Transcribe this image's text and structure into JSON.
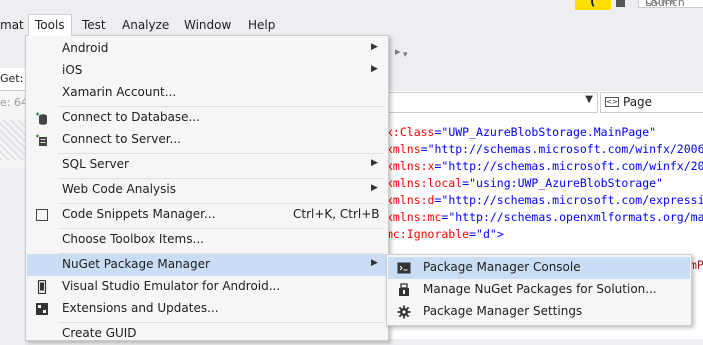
{
  "menubar": {
    "items": [
      "mat",
      "Tools",
      "Test",
      "Analyze",
      "Window",
      "Help"
    ],
    "quick_launch_placeholder": "Quick Launch"
  },
  "left_panel": {
    "tab_label": "Get: U",
    "size_label": "e: 64"
  },
  "editor": {
    "page_dropdown": "Page",
    "lines": [
      {
        "parts": [
          [
            "attr",
            "x:Class"
          ],
          [
            "sym",
            "="
          ],
          [
            "val",
            "\"UWP_AzureBlobStorage.MainPage\""
          ]
        ]
      },
      {
        "parts": [
          [
            "attr",
            "xmlns"
          ],
          [
            "sym",
            "="
          ],
          [
            "val",
            "\"http://schemas.microsoft.com/winfx/2006"
          ]
        ]
      },
      {
        "parts": [
          [
            "attr",
            "xmlns:x"
          ],
          [
            "sym",
            "="
          ],
          [
            "val",
            "\"http://schemas.microsoft.com/winfx/20"
          ]
        ]
      },
      {
        "parts": [
          [
            "attr",
            "xmlns:local"
          ],
          [
            "sym",
            "="
          ],
          [
            "val",
            "\"using:UWP_AzureBlobStorage\""
          ]
        ]
      },
      {
        "parts": [
          [
            "attr",
            "xmlns:d"
          ],
          [
            "sym",
            "="
          ],
          [
            "val",
            "\"http://schemas.microsoft.com/expressi"
          ]
        ]
      },
      {
        "parts": [
          [
            "attr",
            "xmlns:mc"
          ],
          [
            "sym",
            "="
          ],
          [
            "val",
            "\"http://schemas.openxmlformats.org/ma"
          ]
        ]
      },
      {
        "parts": [
          [
            "attr",
            "mc:Ignorable"
          ],
          [
            "sym",
            "="
          ],
          [
            "val",
            "\"d\""
          ],
          [
            "sym",
            ">"
          ]
        ]
      }
    ],
    "tail_text": "mPa"
  },
  "tools_menu": {
    "items": [
      {
        "label": "Android",
        "shortcut": "",
        "submenu": true,
        "icon": ""
      },
      {
        "label": "iOS",
        "shortcut": "",
        "submenu": true,
        "icon": ""
      },
      {
        "label": "Xamarin Account...",
        "shortcut": "",
        "submenu": false,
        "icon": ""
      },
      {
        "label": "Connect to Database...",
        "shortcut": "",
        "submenu": false,
        "icon": "database-icon"
      },
      {
        "label": "Connect to Server...",
        "shortcut": "",
        "submenu": false,
        "icon": "server-icon"
      },
      {
        "label": "SQL Server",
        "shortcut": "",
        "submenu": true,
        "icon": ""
      },
      {
        "label": "Web Code Analysis",
        "shortcut": "",
        "submenu": true,
        "icon": ""
      },
      {
        "label": "Code Snippets Manager...",
        "shortcut": "Ctrl+K, Ctrl+B",
        "submenu": false,
        "icon": "snippet-icon"
      },
      {
        "label": "Choose Toolbox Items...",
        "shortcut": "",
        "submenu": false,
        "icon": ""
      },
      {
        "label": "NuGet Package Manager",
        "shortcut": "",
        "submenu": true,
        "icon": ""
      },
      {
        "label": "Visual Studio Emulator for Android...",
        "shortcut": "",
        "submenu": false,
        "icon": "phone-icon"
      },
      {
        "label": "Extensions and Updates...",
        "shortcut": "",
        "submenu": false,
        "icon": "extensions-icon"
      },
      {
        "label": "Create GUID",
        "shortcut": "",
        "submenu": false,
        "icon": ""
      }
    ]
  },
  "nuget_submenu": {
    "items": [
      {
        "label": "Package Manager Console",
        "icon": "console-icon"
      },
      {
        "label": "Manage NuGet Packages for Solution...",
        "icon": "package-icon"
      },
      {
        "label": "Package Manager Settings",
        "icon": "gear-icon"
      }
    ]
  },
  "colors": {
    "highlight": "#c9def5",
    "accent_yellow": "#ffdf00",
    "xml_attr": "#ff0000",
    "xml_value": "#0000ff"
  }
}
